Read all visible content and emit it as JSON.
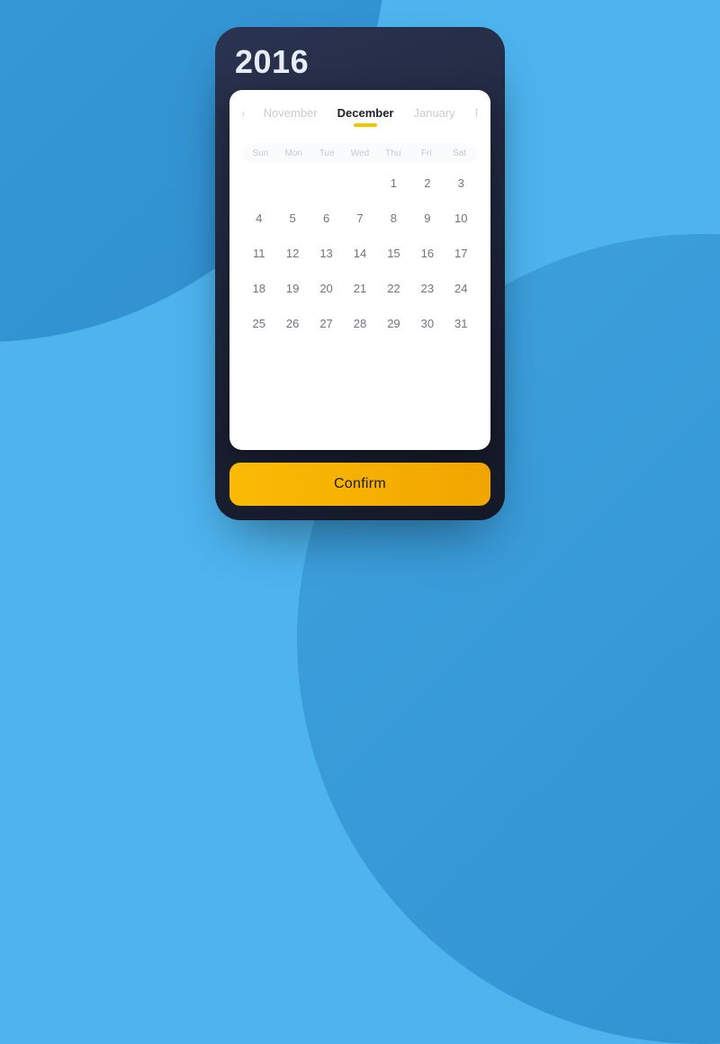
{
  "year": "2016",
  "months": {
    "edge_left": "er",
    "prev": "November",
    "current": "December",
    "next": "January",
    "edge_right": "Febr"
  },
  "weekdays": [
    "Sun",
    "Mon",
    "Tue",
    "Wed",
    "Thu",
    "Fri",
    "Sat"
  ],
  "calendar": {
    "leading_blanks": 4,
    "days_in_month": 31
  },
  "confirm_label": "Confirm",
  "colors": {
    "accent": "#f8c200",
    "card_bg": "#1d2338",
    "page_bg": "#4db4ee"
  }
}
